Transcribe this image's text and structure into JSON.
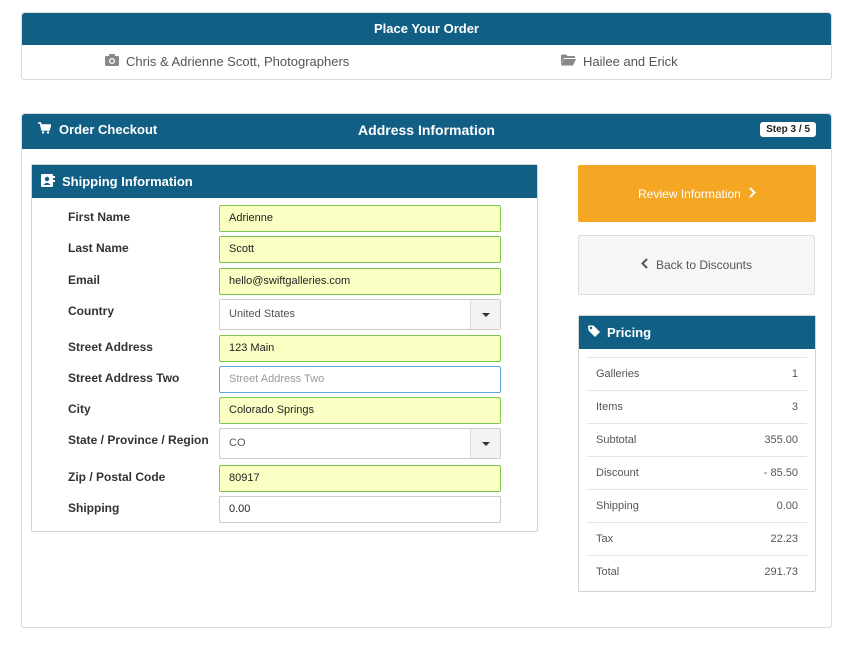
{
  "top": {
    "title": "Place Your Order",
    "photographer": "Chris & Adrienne Scott, Photographers",
    "gallery": "Hailee and Erick"
  },
  "checkout": {
    "title": "Order Checkout",
    "section_title": "Address Information",
    "step": "Step 3 / 5"
  },
  "shipping": {
    "title": "Shipping Information",
    "fields": {
      "first_name": {
        "label": "First Name",
        "value": "Adrienne"
      },
      "last_name": {
        "label": "Last Name",
        "value": "Scott"
      },
      "email": {
        "label": "Email",
        "value": "hello@swiftgalleries.com"
      },
      "country": {
        "label": "Country",
        "value": "United States"
      },
      "street": {
        "label": "Street Address",
        "value": "123 Main"
      },
      "street2": {
        "label": "Street Address Two",
        "placeholder": "Street Address Two"
      },
      "city": {
        "label": "City",
        "value": "Colorado Springs"
      },
      "state": {
        "label": "State / Province / Region",
        "value": "CO"
      },
      "zip": {
        "label": "Zip / Postal Code",
        "value": "80917"
      },
      "shipping": {
        "label": "Shipping",
        "value": "0.00"
      }
    }
  },
  "actions": {
    "review": "Review Information",
    "back": "Back to Discounts"
  },
  "pricing": {
    "title": "Pricing",
    "rows": [
      {
        "label": "Galleries",
        "value": "1"
      },
      {
        "label": "Items",
        "value": "3"
      },
      {
        "label": "Subtotal",
        "value": "355.00"
      },
      {
        "label": "Discount",
        "value": "- 85.50"
      },
      {
        "label": "Shipping",
        "value": "0.00"
      },
      {
        "label": "Tax",
        "value": "22.23"
      },
      {
        "label": "Total",
        "value": "291.73"
      }
    ]
  },
  "icons": {
    "camera": "camera-icon",
    "folder": "folder-icon",
    "cart": "cart-icon",
    "contact": "contact-card-icon",
    "tag": "tag-icon",
    "chevron_right": "chevron-right-icon",
    "chevron_left": "chevron-left-icon",
    "caret": "caret-down-icon"
  },
  "colors": {
    "header_blue": "#125f86",
    "review_orange": "#f5a623",
    "filled_field": "#fbffc4",
    "filled_border": "#7cc94b"
  }
}
